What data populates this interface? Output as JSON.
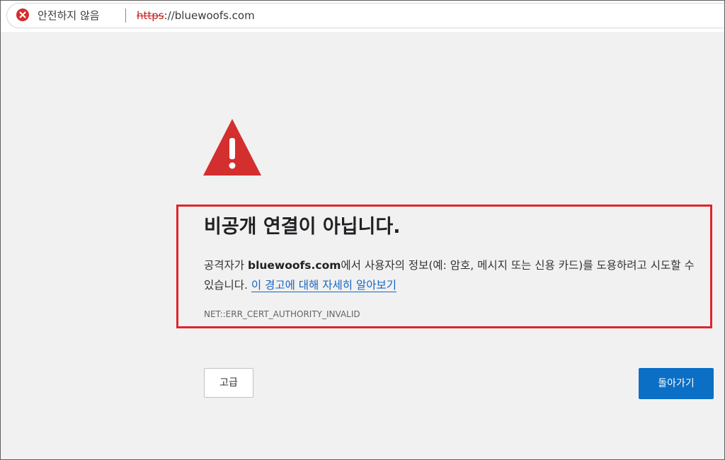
{
  "address_bar": {
    "security_label": "안전하지 않음",
    "url_scheme": "https",
    "url_rest": "://bluewoofs.com",
    "security_icon": "error-circle-icon"
  },
  "warning": {
    "icon": "warning-triangle-icon",
    "title": "비공개 연결이 아닙니다.",
    "desc_prefix": "공격자가 ",
    "desc_domain": "bluewoofs.com",
    "desc_suffix": "에서 사용자의 정보(예: 암호, 메시지 또는 신용 카드)를 도용하려고 시도할 수 있습니다. ",
    "learn_more": "이 경고에 대해 자세히 알아보기",
    "error_code": "NET::ERR_CERT_AUTHORITY_INVALID"
  },
  "buttons": {
    "advanced": "고급",
    "go_back": "돌아가기"
  },
  "colors": {
    "danger": "#d32f2f",
    "highlight_border": "#e0242f",
    "primary_button": "#0b6fc5",
    "link": "#1565c0"
  }
}
